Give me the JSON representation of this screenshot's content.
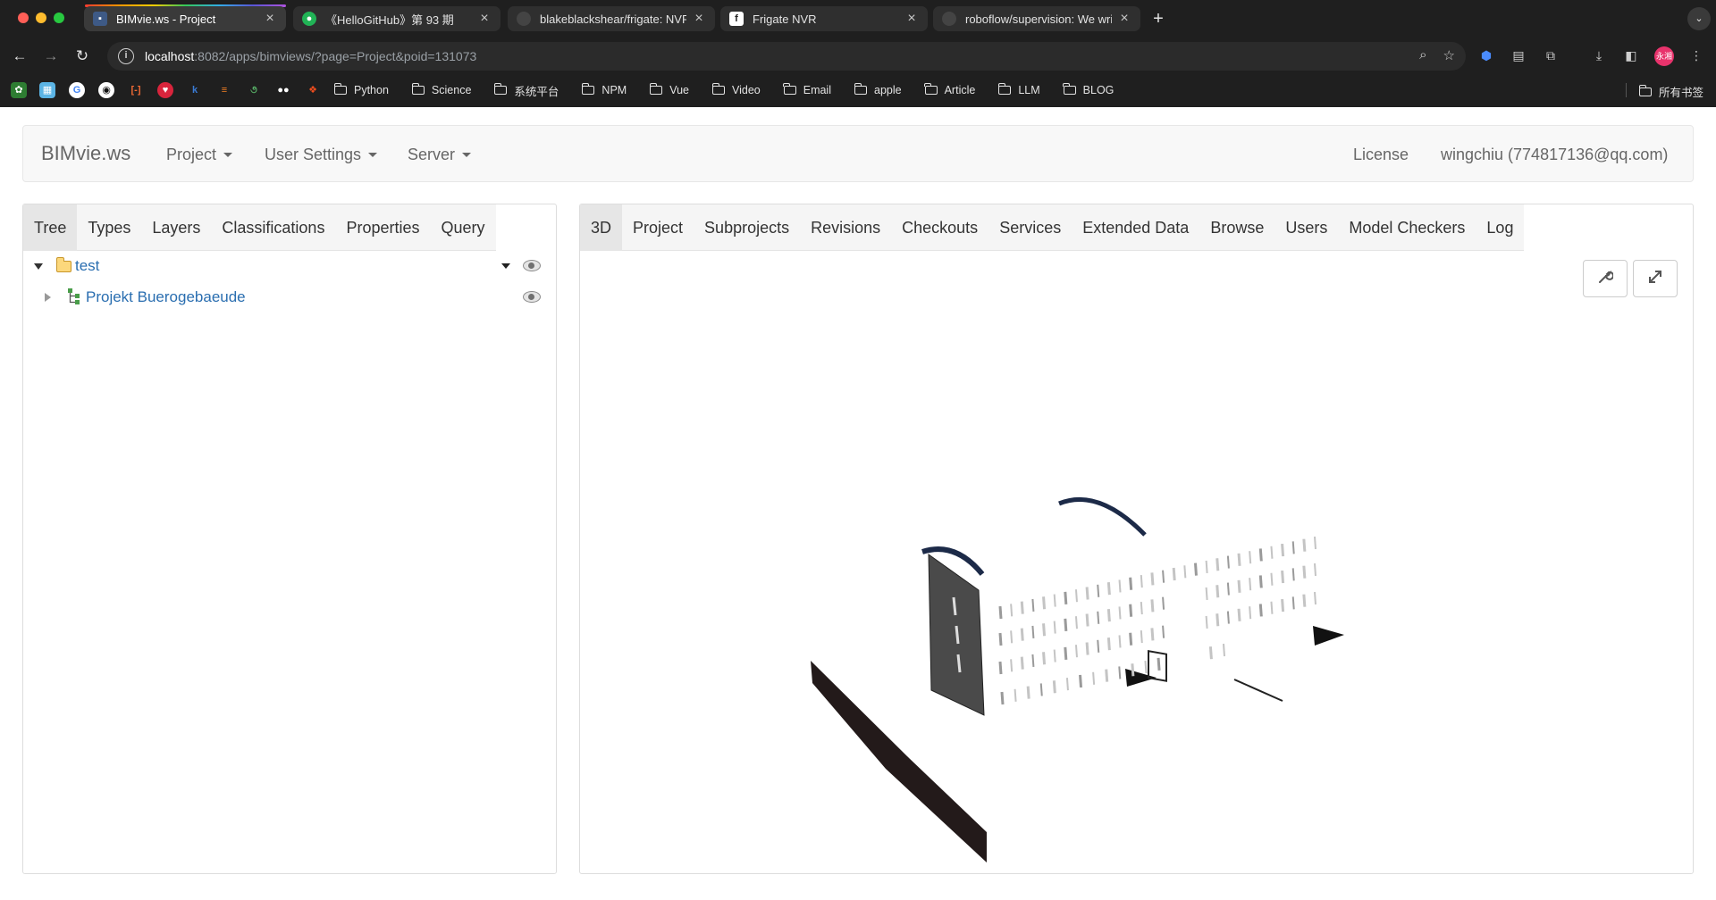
{
  "browser": {
    "tabs": [
      {
        "title": "BIMvie.ws - Project",
        "active": true
      },
      {
        "title": "《HelloGitHub》第 93 期",
        "active": false
      },
      {
        "title": "blakeblackshear/frigate: NVR",
        "active": false
      },
      {
        "title": "Frigate NVR",
        "active": false
      },
      {
        "title": "roboflow/supervision: We writ",
        "active": false
      }
    ],
    "url_host": "localhost",
    "url_rest": ":8082/apps/bimviews/?page=Project&poid=131073",
    "profile_label": "永湘",
    "bookmark_folders": [
      "Python",
      "Science",
      "系统平台",
      "NPM",
      "Vue",
      "Video",
      "Email",
      "apple",
      "Article",
      "LLM",
      "BLOG"
    ],
    "all_bookmarks_label": "所有书签"
  },
  "app": {
    "brand": "BIMvie.ws",
    "nav": {
      "project": "Project",
      "user_settings": "User Settings",
      "server": "Server",
      "license": "License",
      "user": "wingchiu (774817136@qq.com)"
    },
    "left_tabs": [
      "Tree",
      "Types",
      "Layers",
      "Classifications",
      "Properties",
      "Query"
    ],
    "tree": {
      "root_label": "test",
      "child_label": "Projekt Buerogebaeude"
    },
    "right_tabs": [
      "3D",
      "Project",
      "Subprojects",
      "Revisions",
      "Checkouts",
      "Services",
      "Extended Data",
      "Browse",
      "Users",
      "Model Checkers",
      "Log"
    ]
  }
}
